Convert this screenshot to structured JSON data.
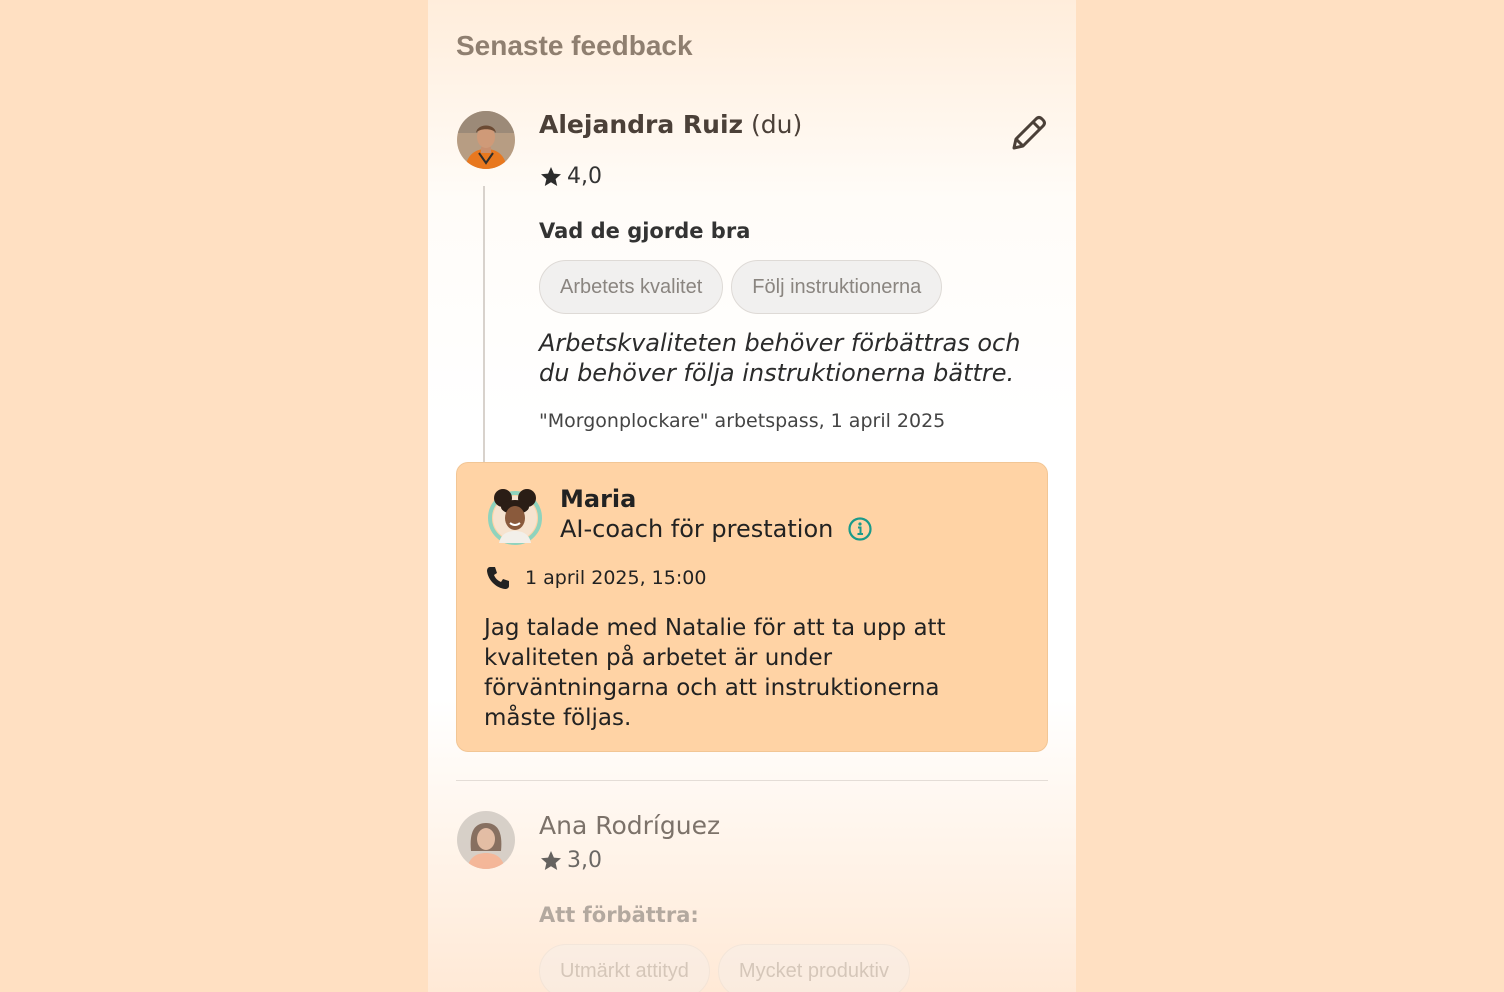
{
  "section_title": "Senaste feedback",
  "feedback": [
    {
      "name": "Alejandra Ruiz",
      "name_suffix": "(du)",
      "rating": "4,0",
      "heading": "Vad de gjorde bra",
      "chips": [
        "Arbetets kvalitet",
        "Följ instruktionerna"
      ],
      "comment": "Arbetskvaliteten behöver förbättras och du behöver följa instruktionerna bättre.",
      "meta": "\"Morgonplockare\" arbetspass, 1 april 2025",
      "coach": {
        "name": "Maria",
        "role": "AI-coach för prestation",
        "call_time": "1 april 2025, 15:00",
        "message": "Jag talade med Natalie för att ta upp att kvaliteten på arbetet är under förväntningarna och att instruktionerna måste följas."
      }
    },
    {
      "name": "Ana Rodríguez",
      "rating": "3,0",
      "heading": "Att förbättra:",
      "chips": [
        "Utmärkt attityd",
        "Mycket produktiv"
      ]
    }
  ],
  "colors": {
    "page_bg": "#FFE0C2",
    "coach_card_bg": "#FFD3A5",
    "info_accent": "#1a9a8a"
  },
  "icons": [
    "star-icon",
    "pencil-icon",
    "info-icon",
    "phone-icon"
  ]
}
